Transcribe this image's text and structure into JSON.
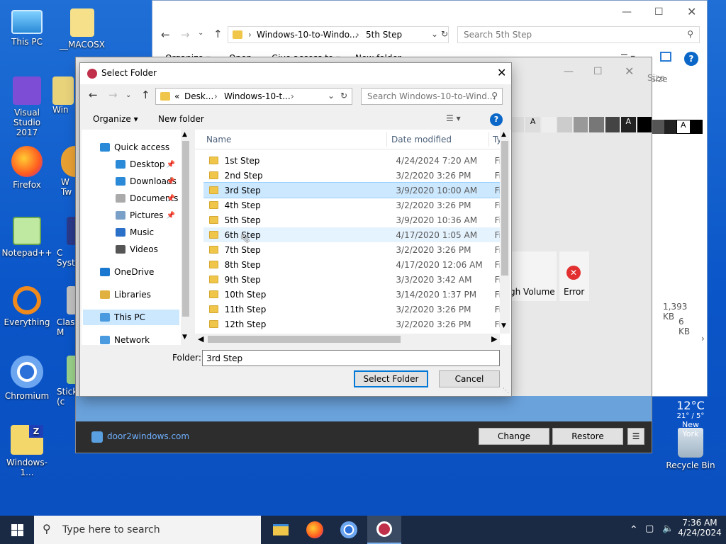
{
  "desktop": {
    "icons": [
      {
        "label": "This PC"
      },
      {
        "label": "__MACOSX"
      },
      {
        "label": "Visual Studio 2017"
      },
      {
        "label": "Win"
      },
      {
        "label": "Firefox"
      },
      {
        "label": "W Tw"
      },
      {
        "label": "Notepad++"
      },
      {
        "label": "C Syste"
      },
      {
        "label": "Everything"
      },
      {
        "label": "Clas M"
      },
      {
        "label": "Chromium"
      },
      {
        "label": "Stick (c"
      },
      {
        "label": "Windows-1..."
      },
      {
        "label": "Recycle Bin"
      }
    ]
  },
  "explorer": {
    "breadcrumb": [
      "Windows-10-to-Windo...",
      "5th Step"
    ],
    "search_placeholder": "Search 5th Step",
    "menu": [
      "Organize",
      "Open",
      "Give access to",
      "New folder"
    ],
    "size_header": "Size",
    "sizes": [
      "1,393 KB",
      "6 KB"
    ]
  },
  "app": {
    "weather_temp": "12°C",
    "weather_range": "21° / 5°",
    "weather_city": "New York",
    "tiles": [
      "gh Volume",
      "Error"
    ],
    "footer_link": "door2windows.com",
    "buttons": {
      "change": "Change",
      "restore": "Restore"
    }
  },
  "dialog": {
    "title": "Select Folder",
    "breadcrumb": [
      "«",
      "Desk...",
      "Windows-10-t..."
    ],
    "search_placeholder": "Search Windows-10-to-Wind...",
    "organize": "Organize",
    "new_folder": "New folder",
    "columns": {
      "name": "Name",
      "date": "Date modified",
      "type": "Ty"
    },
    "nav": [
      {
        "label": "Quick access",
        "pinned": false
      },
      {
        "label": "Desktop",
        "pinned": true
      },
      {
        "label": "Downloads",
        "pinned": true
      },
      {
        "label": "Documents",
        "pinned": true
      },
      {
        "label": "Pictures",
        "pinned": true
      },
      {
        "label": "Music",
        "pinned": false
      },
      {
        "label": "Videos",
        "pinned": false
      },
      {
        "label": "OneDrive",
        "pinned": false
      },
      {
        "label": "Libraries",
        "pinned": false
      },
      {
        "label": "This PC",
        "pinned": false
      },
      {
        "label": "Network",
        "pinned": false
      }
    ],
    "rows": [
      {
        "name": "1st Step",
        "date": "4/24/2024 7:20 AM",
        "type": "Fi"
      },
      {
        "name": "2nd Step",
        "date": "3/2/2020 3:26 PM",
        "type": "Fi"
      },
      {
        "name": "3rd Step",
        "date": "3/9/2020 10:00 AM",
        "type": "Fi"
      },
      {
        "name": "4th Step",
        "date": "3/2/2020 3:26 PM",
        "type": "Fi"
      },
      {
        "name": "5th Step",
        "date": "3/9/2020 10:36 AM",
        "type": "Fi"
      },
      {
        "name": "6th Step",
        "date": "4/17/2020 1:05 AM",
        "type": "Fi"
      },
      {
        "name": "7th Step",
        "date": "3/2/2020 3:26 PM",
        "type": "Fi"
      },
      {
        "name": "8th Step",
        "date": "4/17/2020 12:06 AM",
        "type": "Fi"
      },
      {
        "name": "9th Step",
        "date": "3/3/2020 3:42 AM",
        "type": "Fi"
      },
      {
        "name": "10th Step",
        "date": "3/14/2020 1:37 PM",
        "type": "Fi"
      },
      {
        "name": "11th Step",
        "date": "3/2/2020 3:26 PM",
        "type": "Fi"
      },
      {
        "name": "12th Step",
        "date": "3/2/2020 3:26 PM",
        "type": "Fi"
      }
    ],
    "selected_row": "3rd Step",
    "hover_row": "6th Step",
    "folder_label": "Folder:",
    "folder_value": "3rd Step",
    "select_button": "Select Folder",
    "cancel_button": "Cancel"
  },
  "taskbar": {
    "search_placeholder": "Type here to search",
    "time": "7:36 AM",
    "date": "4/24/2024"
  },
  "colors": {
    "accent": "#0078d7",
    "selection": "#cce8ff",
    "hover": "#e5f3ff",
    "taskbar": "#1a2a44"
  }
}
